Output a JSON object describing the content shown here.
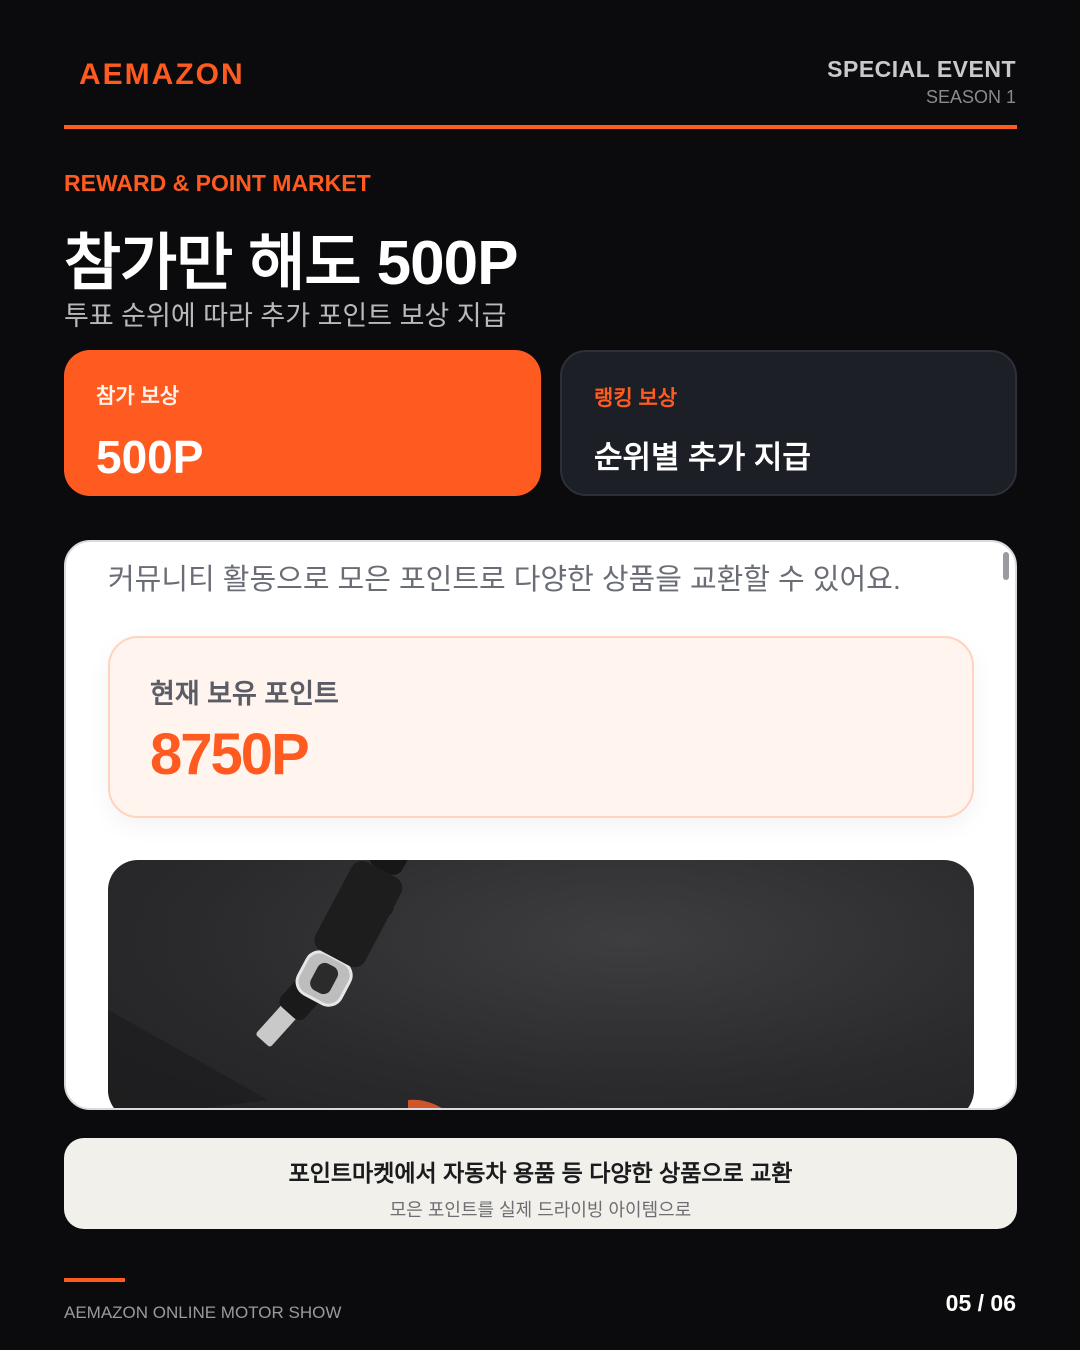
{
  "header": {
    "brand": "AEMAZON",
    "event_title": "SPECIAL EVENT",
    "event_season": "SEASON 1"
  },
  "hero": {
    "kicker": "REWARD & POINT MARKET",
    "headline": "참가만 해도 500P",
    "subline": "투표 순위에 따라 추가 포인트 보상 지급"
  },
  "cards": {
    "participation": {
      "label": "참가 보상",
      "value": "500P"
    },
    "ranking": {
      "label": "랭킹 보상",
      "value": "순위별 추가 지급"
    }
  },
  "phone": {
    "intro": "커뮤니티 활동으로 모은 포인트로 다양한 상품을 교환할 수 있어요.",
    "points_label": "현재 보유 포인트",
    "points_value": "8750P"
  },
  "banner": {
    "title": "포인트마켓에서 자동차 용품 등 다양한 상품으로 교환",
    "subtitle": "모은 포인트를 실제 드라이빙 아이템으로"
  },
  "footer": {
    "brand": "AEMAZON ONLINE MOTOR SHOW",
    "page": "05 / 06"
  },
  "colors": {
    "accent": "#ff5a1f",
    "background": "#0b0b0d",
    "card_dark": "#1c1f26",
    "banner_bg": "#f1f0ea"
  }
}
